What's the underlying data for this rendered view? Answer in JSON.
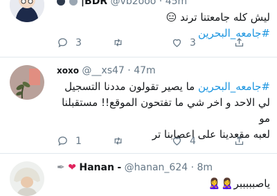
{
  "tweets": [
    {
      "name": "|BDR",
      "name_prefix_icons": [
        "dark-circle-emoji",
        "grey-circle-emoji"
      ],
      "handle": "@vb2ooo",
      "sep": "·",
      "time": "45m",
      "text_pre": "ليش كله جامعتنا ترند",
      "emoji": "😑",
      "hashtag": "#جامعه_البحرين",
      "replies": "3",
      "retweets": "",
      "likes": "3"
    },
    {
      "name": "xoxo",
      "handle": "@__xs47",
      "sep": "·",
      "time": "47m",
      "hashtag": "#جامعه_البحرين",
      "line1": " ما يصير تقولون مددنا التسجيل",
      "line2": "لي الاحد و اخر شي ما تفتحون الموقع!! مستقبلنا مو",
      "line3": "لعبه مقعدينا على اعصابنا تر",
      "replies": "1",
      "retweets": "",
      "likes": "4"
    },
    {
      "name": "Hanan",
      "name_icons": [
        "feather-icon",
        "red-heart-icon"
      ],
      "handle": "@hanan_624",
      "sep": "·",
      "time": "8m",
      "text": "ياصبببببر",
      "emoji": "🙎‍♀️🙎‍♀️"
    }
  ],
  "colors": {
    "link": "#1b95e0",
    "meta": "#657786",
    "text": "#14171a",
    "divider": "#e1e8ed"
  }
}
